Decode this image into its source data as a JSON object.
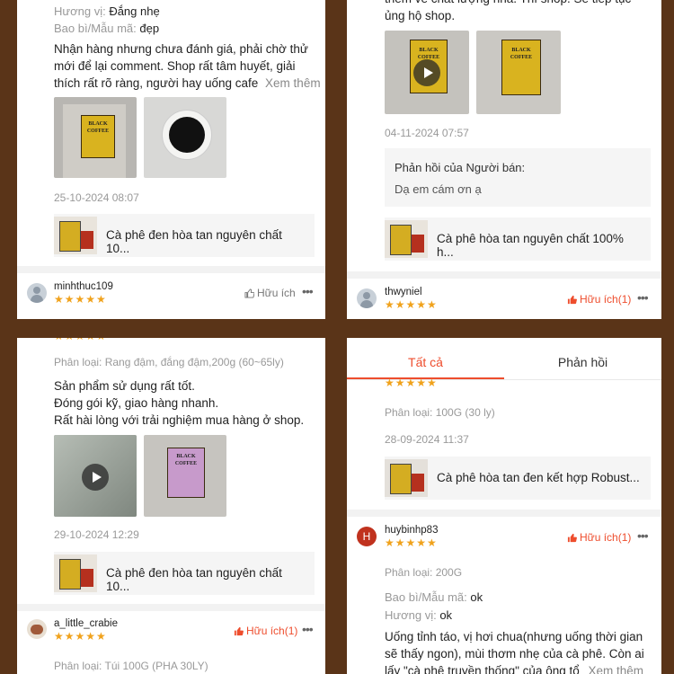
{
  "colors": {
    "accent": "#ee4d2d",
    "star": "#f0a21c",
    "background": "#5a3418"
  },
  "panel1": {
    "flavor_label": "Hương vị:",
    "flavor_value": "Đắng nhẹ",
    "packaging_label": "Bao bì/Mẫu mã:",
    "packaging_value": "đẹp",
    "comment_lines": [
      "Nhận hàng nhưng chưa đánh giá, phải chờ thử",
      "mới để lại comment. Shop rất tâm huyết, giải",
      "thích rất rõ ràng, người hay uống cafe"
    ],
    "see_more": "Xem thêm",
    "date": "25-10-2024 08:07",
    "product_name": "Cà phê đen hòa tan nguyên chất 10...",
    "next_user": "minhthuc109",
    "next_stars": "★★★★★",
    "next_helpful": "Hữu ích"
  },
  "panel2": {
    "partial_lines": [
      "thêm về chất lượng nha. Thì shop. Sẽ tiếp tục",
      "ủng hộ shop."
    ],
    "date": "04-11-2024 07:57",
    "reply_title": "Phản hồi của Người bán:",
    "reply_text": "Dạ em cám ơn ạ",
    "product_name": "Cà phê hòa tan nguyên chất 100% h...",
    "next_user": "thwyniel",
    "next_stars": "★★★★★",
    "next_helpful": "Hữu ích(1)"
  },
  "panel3": {
    "variant": "Phân loại: Rang đậm, đắng đậm,200g (60~65ly)",
    "comment_lines": [
      "Sản phẩm sử dụng rất tốt.",
      "Đóng gói kỹ, giao hàng nhanh.",
      "Rất hài lòng với trải nghiệm mua hàng ở shop."
    ],
    "date": "29-10-2024 12:29",
    "product_name": "Cà phê đen hòa tan nguyên chất 10...",
    "next_user": "a_little_crabie",
    "next_stars": "★★★★★",
    "next_helpful": "Hữu ích(1)",
    "next_variant": "Phân loại: Túi 100G (PHA 30LY)"
  },
  "panel4": {
    "tabs": [
      "Tất cả",
      "Phản hồi"
    ],
    "variant": "Phân loại: 100G (30 ly)",
    "date": "28-09-2024 11:37",
    "product_name": "Cà phê hòa tan đen kết hợp Robust...",
    "user": "huybinhp83",
    "avatar_letter": "H",
    "stars": "★★★★★",
    "helpful": "Hữu ích(1)",
    "variant2": "Phân loại: 200G",
    "packaging_label": "Bao bì/Mẫu mã:",
    "packaging_value": "ok",
    "flavor_label": "Hương vị:",
    "flavor_value": "ok",
    "comment_lines": [
      "Uống tỉnh táo, vị hơi chua(nhưng uống thời gian",
      "sẽ thấy ngon), mùi thơm nhẹ của cà phê. Còn ai",
      "lấy \"cà phê truyền thống\" của ông tổ"
    ],
    "see_more": "Xem thêm"
  },
  "image_labels": {
    "brand_line1": "BLACK",
    "brand_line2": "COFFEE"
  },
  "icons": [
    "play-icon",
    "thumbs-up-icon",
    "more-options-icon",
    "user-avatar-icon"
  ]
}
